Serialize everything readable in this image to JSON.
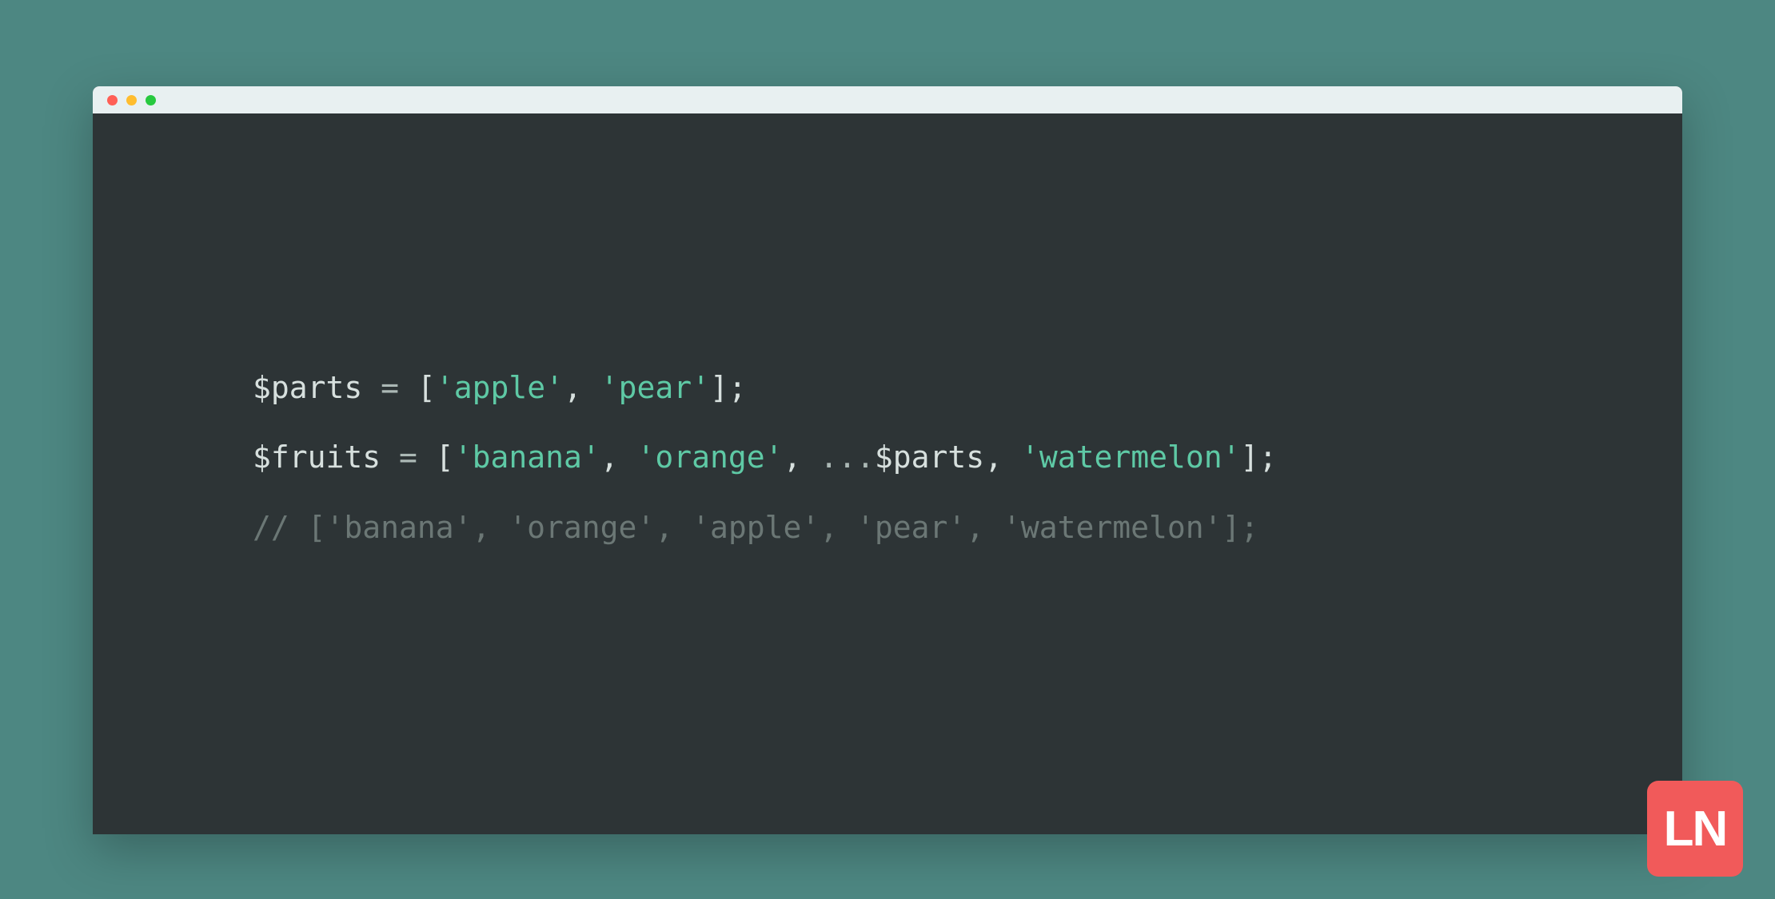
{
  "colors": {
    "background": "#4d8782",
    "editor_bg": "#2d3436",
    "titlebar_bg": "#e8f0f1",
    "string": "#5ec9a5",
    "default": "#d7e0de",
    "comment": "#6b7775",
    "punct": "#abb8b5",
    "badge_bg": "#f15a5a"
  },
  "traffic_lights": [
    "red",
    "yellow",
    "green"
  ],
  "code": {
    "line1": {
      "seg1": "$parts ",
      "seg2": "=",
      "seg3": " [",
      "seg4": "'apple'",
      "seg5": ", ",
      "seg6": "'pear'",
      "seg7": "];"
    },
    "line2": {
      "seg1": "$fruits ",
      "seg2": "=",
      "seg3": " [",
      "seg4": "'banana'",
      "seg5": ", ",
      "seg6": "'orange'",
      "seg7": ", ",
      "seg8": "...",
      "seg9": "$parts, ",
      "seg10": "'watermelon'",
      "seg11": "];"
    },
    "line3": {
      "seg1": "// ['banana', 'orange', 'apple', 'pear', 'watermelon'];"
    }
  },
  "badge": {
    "text": "LN"
  }
}
